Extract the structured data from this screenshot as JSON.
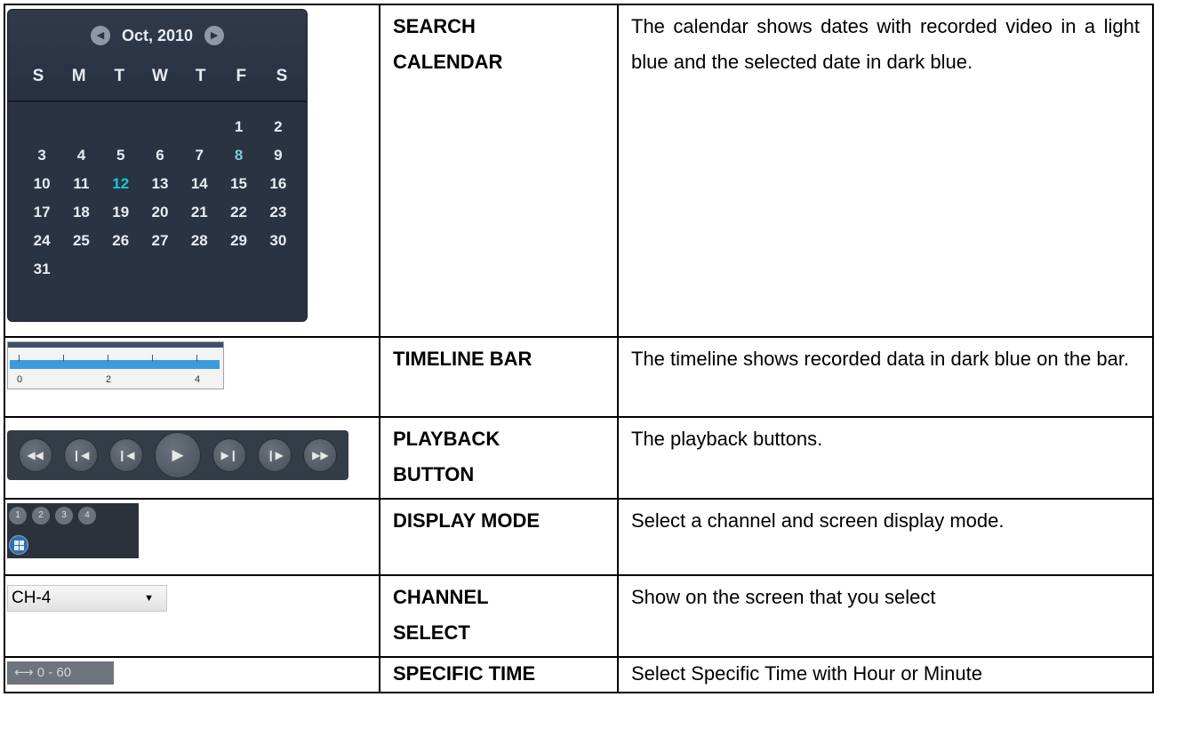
{
  "rows": [
    {
      "name_lines": [
        "SEARCH",
        "CALENDAR"
      ],
      "description": "The calendar shows dates with recorded video in a light blue and the selected date in dark blue."
    },
    {
      "name_lines": [
        "TIMELINE BAR"
      ],
      "description": "The timeline shows recorded data in dark blue on the bar."
    },
    {
      "name_lines": [
        "PLAYBACK",
        "BUTTON"
      ],
      "description": "The playback buttons."
    },
    {
      "name_lines": [
        "DISPLAY MODE"
      ],
      "description": "Select a channel and screen display mode."
    },
    {
      "name_lines": [
        "CHANNEL",
        "SELECT"
      ],
      "description": "Show on the screen that you select"
    },
    {
      "name_lines": [
        "SPECIFIC TIME"
      ],
      "description": "Select Specific Time with Hour or Minute"
    }
  ],
  "calendar": {
    "month_label": "Oct, 2010",
    "weekdays": [
      "S",
      "M",
      "T",
      "W",
      "T",
      "F",
      "S"
    ],
    "days": [
      "",
      "",
      "",
      "",
      "",
      "1",
      "2",
      "3",
      "4",
      "5",
      "6",
      "7",
      "8",
      "9",
      "10",
      "11",
      "12",
      "13",
      "14",
      "15",
      "16",
      "17",
      "18",
      "19",
      "20",
      "21",
      "22",
      "23",
      "24",
      "25",
      "26",
      "27",
      "28",
      "29",
      "30",
      "31"
    ],
    "recorded_days": [
      "8"
    ],
    "selected_day": "12",
    "icons": {
      "prev": "chevron-left-icon",
      "next": "chevron-right-icon"
    }
  },
  "timeline": {
    "labels": [
      "0",
      "2",
      "4"
    ],
    "bar_color": "#3c9bde"
  },
  "playback": {
    "buttons": [
      "rewind-icon",
      "step-back-icon",
      "prev-frame-icon",
      "play-icon",
      "next-frame-icon",
      "step-forward-icon",
      "fast-forward-icon"
    ]
  },
  "display_mode": {
    "channels": [
      "1",
      "2",
      "3",
      "4"
    ],
    "quad_icon": "quad-view-icon"
  },
  "channel_select": {
    "value": "CH-4"
  },
  "specific_time": {
    "value": "0 - 60",
    "icon": "range-icon"
  }
}
